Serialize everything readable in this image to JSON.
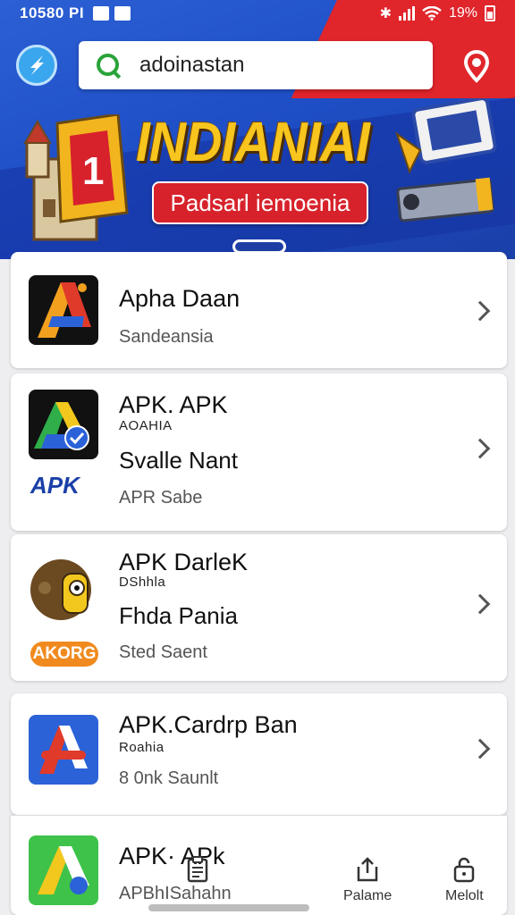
{
  "status_bar": {
    "time": "10580 PI",
    "battery": "19%"
  },
  "search": {
    "value": "adoinastan",
    "icon": "search-icon"
  },
  "banner": {
    "title": "INDIANIAI",
    "pill": "Padsarl iemoenia"
  },
  "colors": {
    "brand_blue": "#1f4fc7",
    "accent_red": "#e0252b",
    "banner_yellow": "#f7c51e",
    "search_green": "#2aa43a"
  },
  "apps": [
    {
      "title": "Apha Daan",
      "subtitle": "Sandeansia"
    },
    {
      "title": "APK. APK",
      "developer": "AOAHIA",
      "name": "Svalle Nant",
      "tag": "APK",
      "subtitle": "APR Sabe"
    },
    {
      "title": "APK DarleK",
      "developer": "DShhla",
      "name": "Fhda Pania",
      "tag": "AKORG",
      "subtitle": "Sted Saent"
    },
    {
      "title": "APK.Cardrp Ban",
      "developer": "Roahia",
      "subtitle": "8 0nk Saunlt"
    },
    {
      "title": "APK· APk",
      "subtitle": "APBhISahahn"
    }
  ],
  "bottom_nav": [
    {
      "label": "",
      "icon": "clipboard-icon"
    },
    {
      "label": "Palame",
      "icon": "share-icon"
    },
    {
      "label": "Melolt",
      "icon": "lock-icon"
    }
  ]
}
